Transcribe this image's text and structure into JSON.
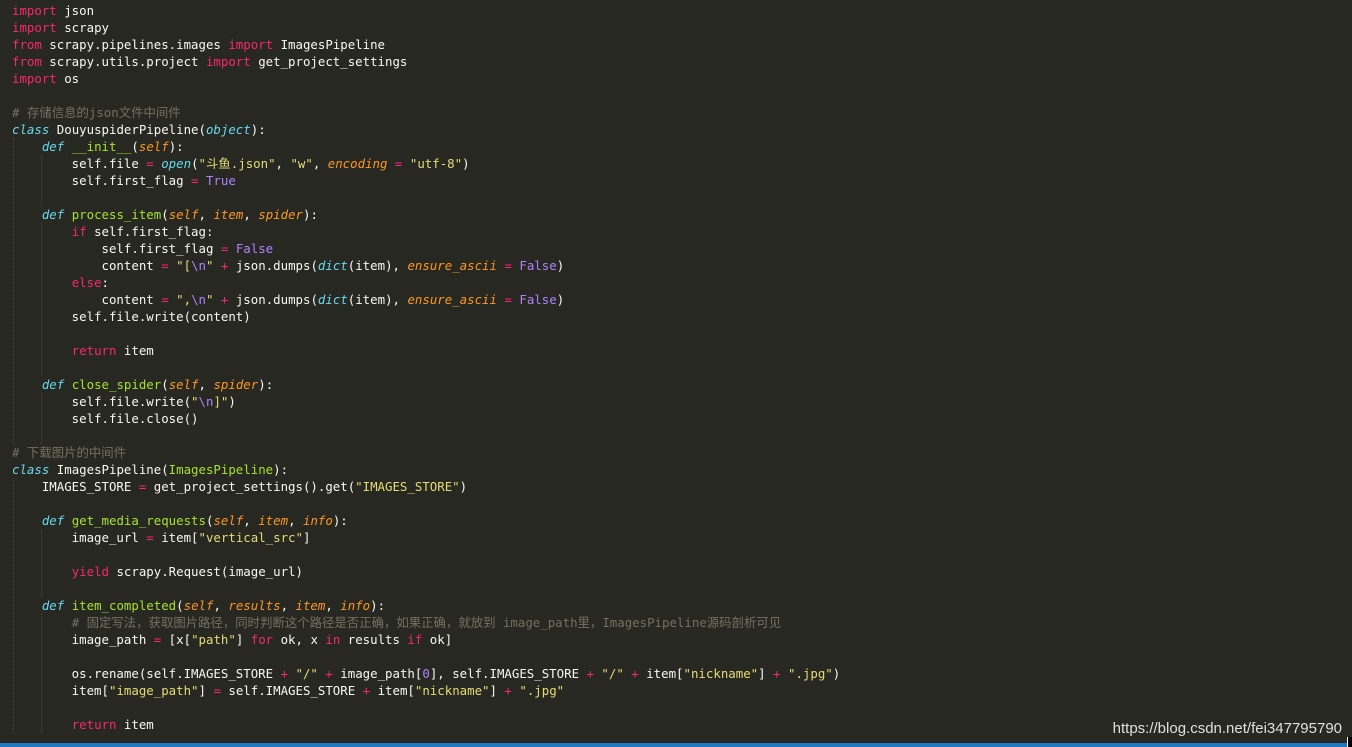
{
  "editor": {
    "lines": [
      [
        [
          "kw",
          "import"
        ],
        [
          "t",
          " json"
        ]
      ],
      [
        [
          "kw",
          "import"
        ],
        [
          "t",
          " scrapy"
        ]
      ],
      [
        [
          "kw",
          "from"
        ],
        [
          "t",
          " scrapy.pipelines.images "
        ],
        [
          "kw",
          "import"
        ],
        [
          "t",
          " ImagesPipeline"
        ]
      ],
      [
        [
          "kw",
          "from"
        ],
        [
          "t",
          " scrapy.utils.project "
        ],
        [
          "kw",
          "import"
        ],
        [
          "t",
          " get_project_settings"
        ]
      ],
      [
        [
          "kw",
          "import"
        ],
        [
          "t",
          " os"
        ]
      ],
      [],
      [
        [
          "cm",
          "# 存储信息的json文件中间件"
        ]
      ],
      [
        [
          "df",
          "class"
        ],
        [
          "t",
          " DouyuspiderPipeline("
        ],
        [
          "cls",
          "object"
        ],
        [
          "t",
          "):"
        ]
      ],
      [
        [
          "t",
          "    "
        ],
        [
          "df",
          "def"
        ],
        [
          "t",
          " "
        ],
        [
          "fn",
          "__init__"
        ],
        [
          "t",
          "("
        ],
        [
          "par",
          "self"
        ],
        [
          "t",
          "):"
        ]
      ],
      [
        [
          "t",
          "        self.file "
        ],
        [
          "op",
          "="
        ],
        [
          "t",
          " "
        ],
        [
          "bi",
          "open"
        ],
        [
          "t",
          "("
        ],
        [
          "st",
          "\"斗鱼.json\""
        ],
        [
          "t",
          ", "
        ],
        [
          "st",
          "\"w\""
        ],
        [
          "t",
          ", "
        ],
        [
          "par",
          "encoding"
        ],
        [
          "t",
          " "
        ],
        [
          "op",
          "="
        ],
        [
          "t",
          " "
        ],
        [
          "st",
          "\"utf-8\""
        ],
        [
          "t",
          ")"
        ]
      ],
      [
        [
          "t",
          "        self.first_flag "
        ],
        [
          "op",
          "="
        ],
        [
          "t",
          " "
        ],
        [
          "cst",
          "True"
        ]
      ],
      [],
      [
        [
          "t",
          "    "
        ],
        [
          "df",
          "def"
        ],
        [
          "t",
          " "
        ],
        [
          "fn",
          "process_item"
        ],
        [
          "t",
          "("
        ],
        [
          "par",
          "self"
        ],
        [
          "t",
          ", "
        ],
        [
          "par",
          "item"
        ],
        [
          "t",
          ", "
        ],
        [
          "par",
          "spider"
        ],
        [
          "t",
          "):"
        ]
      ],
      [
        [
          "t",
          "        "
        ],
        [
          "kw",
          "if"
        ],
        [
          "t",
          " self.first_flag:"
        ]
      ],
      [
        [
          "t",
          "            self.first_flag "
        ],
        [
          "op",
          "="
        ],
        [
          "t",
          " "
        ],
        [
          "cst",
          "False"
        ]
      ],
      [
        [
          "t",
          "            content "
        ],
        [
          "op",
          "="
        ],
        [
          "t",
          " "
        ],
        [
          "st",
          "\"["
        ],
        [
          "es",
          "\\n"
        ],
        [
          "st",
          "\""
        ],
        [
          "t",
          " "
        ],
        [
          "op",
          "+"
        ],
        [
          "t",
          " json.dumps("
        ],
        [
          "bi",
          "dict"
        ],
        [
          "t",
          "(item), "
        ],
        [
          "par",
          "ensure_ascii"
        ],
        [
          "t",
          " "
        ],
        [
          "op",
          "="
        ],
        [
          "t",
          " "
        ],
        [
          "cst",
          "False"
        ],
        [
          "t",
          ")"
        ]
      ],
      [
        [
          "t",
          "        "
        ],
        [
          "kw",
          "else"
        ],
        [
          "t",
          ":"
        ]
      ],
      [
        [
          "t",
          "            content "
        ],
        [
          "op",
          "="
        ],
        [
          "t",
          " "
        ],
        [
          "st",
          "\","
        ],
        [
          "es",
          "\\n"
        ],
        [
          "st",
          "\""
        ],
        [
          "t",
          " "
        ],
        [
          "op",
          "+"
        ],
        [
          "t",
          " json.dumps("
        ],
        [
          "bi",
          "dict"
        ],
        [
          "t",
          "(item), "
        ],
        [
          "par",
          "ensure_ascii"
        ],
        [
          "t",
          " "
        ],
        [
          "op",
          "="
        ],
        [
          "t",
          " "
        ],
        [
          "cst",
          "False"
        ],
        [
          "t",
          ")"
        ]
      ],
      [
        [
          "t",
          "        self.file.write(content)"
        ]
      ],
      [],
      [
        [
          "t",
          "        "
        ],
        [
          "kw",
          "return"
        ],
        [
          "t",
          " item"
        ]
      ],
      [],
      [
        [
          "t",
          "    "
        ],
        [
          "df",
          "def"
        ],
        [
          "t",
          " "
        ],
        [
          "fn",
          "close_spider"
        ],
        [
          "t",
          "("
        ],
        [
          "par",
          "self"
        ],
        [
          "t",
          ", "
        ],
        [
          "par",
          "spider"
        ],
        [
          "t",
          "):"
        ]
      ],
      [
        [
          "t",
          "        self.file.write("
        ],
        [
          "st",
          "\""
        ],
        [
          "es",
          "\\n"
        ],
        [
          "st",
          "]\""
        ],
        [
          "t",
          ")"
        ]
      ],
      [
        [
          "t",
          "        self.file.close()"
        ]
      ],
      [],
      [
        [
          "cm",
          "# 下载图片的中间件"
        ]
      ],
      [
        [
          "df",
          "class"
        ],
        [
          "t",
          " ImagesPipeline("
        ],
        [
          "fn",
          "ImagesPipeline"
        ],
        [
          "t",
          "):"
        ]
      ],
      [
        [
          "t",
          "    IMAGES_STORE "
        ],
        [
          "op",
          "="
        ],
        [
          "t",
          " get_project_settings().get("
        ],
        [
          "st",
          "\"IMAGES_STORE\""
        ],
        [
          "t",
          ")"
        ]
      ],
      [],
      [
        [
          "t",
          "    "
        ],
        [
          "df",
          "def"
        ],
        [
          "t",
          " "
        ],
        [
          "fn",
          "get_media_requests"
        ],
        [
          "t",
          "("
        ],
        [
          "par",
          "self"
        ],
        [
          "t",
          ", "
        ],
        [
          "par",
          "item"
        ],
        [
          "t",
          ", "
        ],
        [
          "par",
          "info"
        ],
        [
          "t",
          "):"
        ]
      ],
      [
        [
          "t",
          "        image_url "
        ],
        [
          "op",
          "="
        ],
        [
          "t",
          " item["
        ],
        [
          "st",
          "\"vertical_src\""
        ],
        [
          "t",
          "]"
        ]
      ],
      [],
      [
        [
          "t",
          "        "
        ],
        [
          "kw",
          "yield"
        ],
        [
          "t",
          " scrapy.Request(image_url)"
        ]
      ],
      [],
      [
        [
          "t",
          "    "
        ],
        [
          "df",
          "def"
        ],
        [
          "t",
          " "
        ],
        [
          "fn",
          "item_completed"
        ],
        [
          "t",
          "("
        ],
        [
          "par",
          "self"
        ],
        [
          "t",
          ", "
        ],
        [
          "par",
          "results"
        ],
        [
          "t",
          ", "
        ],
        [
          "par",
          "item"
        ],
        [
          "t",
          ", "
        ],
        [
          "par",
          "info"
        ],
        [
          "t",
          "):"
        ]
      ],
      [
        [
          "t",
          "        "
        ],
        [
          "cm",
          "# 固定写法，获取图片路径，同时判断这个路径是否正确，如果正确，就放到 image_path里，ImagesPipeline源码剖析可见"
        ]
      ],
      [
        [
          "t",
          "        image_path "
        ],
        [
          "op",
          "="
        ],
        [
          "t",
          " [x["
        ],
        [
          "st",
          "\"path\""
        ],
        [
          "t",
          "] "
        ],
        [
          "kw",
          "for"
        ],
        [
          "t",
          " ok, x "
        ],
        [
          "kw",
          "in"
        ],
        [
          "t",
          " results "
        ],
        [
          "kw",
          "if"
        ],
        [
          "t",
          " ok]"
        ]
      ],
      [],
      [
        [
          "t",
          "        os.rename(self.IMAGES_STORE "
        ],
        [
          "op",
          "+"
        ],
        [
          "t",
          " "
        ],
        [
          "st",
          "\"/\""
        ],
        [
          "t",
          " "
        ],
        [
          "op",
          "+"
        ],
        [
          "t",
          " image_path["
        ],
        [
          "num",
          "0"
        ],
        [
          "t",
          "], self.IMAGES_STORE "
        ],
        [
          "op",
          "+"
        ],
        [
          "t",
          " "
        ],
        [
          "st",
          "\"/\""
        ],
        [
          "t",
          " "
        ],
        [
          "op",
          "+"
        ],
        [
          "t",
          " item["
        ],
        [
          "st",
          "\"nickname\""
        ],
        [
          "t",
          "] "
        ],
        [
          "op",
          "+"
        ],
        [
          "t",
          " "
        ],
        [
          "st",
          "\".jpg\""
        ],
        [
          "t",
          ")"
        ]
      ],
      [
        [
          "t",
          "        item["
        ],
        [
          "st",
          "\"image_path\""
        ],
        [
          "t",
          "] "
        ],
        [
          "op",
          "="
        ],
        [
          "t",
          " self.IMAGES_STORE "
        ],
        [
          "op",
          "+"
        ],
        [
          "t",
          " item["
        ],
        [
          "st",
          "\"nickname\""
        ],
        [
          "t",
          "] "
        ],
        [
          "op",
          "+"
        ],
        [
          "t",
          " "
        ],
        [
          "st",
          "\".jpg\""
        ]
      ],
      [],
      [
        [
          "t",
          "        "
        ],
        [
          "kw",
          "return"
        ],
        [
          "t",
          " item"
        ]
      ]
    ]
  },
  "watermark": "https://blog.csdn.net/fei347795790",
  "colors": {
    "background": "#272822",
    "keyword": "#f92672",
    "storage": "#66d9ef",
    "function": "#a6e22e",
    "parameter": "#fd971f",
    "string": "#e6db74",
    "constant": "#ae81ff",
    "comment": "#75715e",
    "statusbar": "#1e7ac0"
  }
}
